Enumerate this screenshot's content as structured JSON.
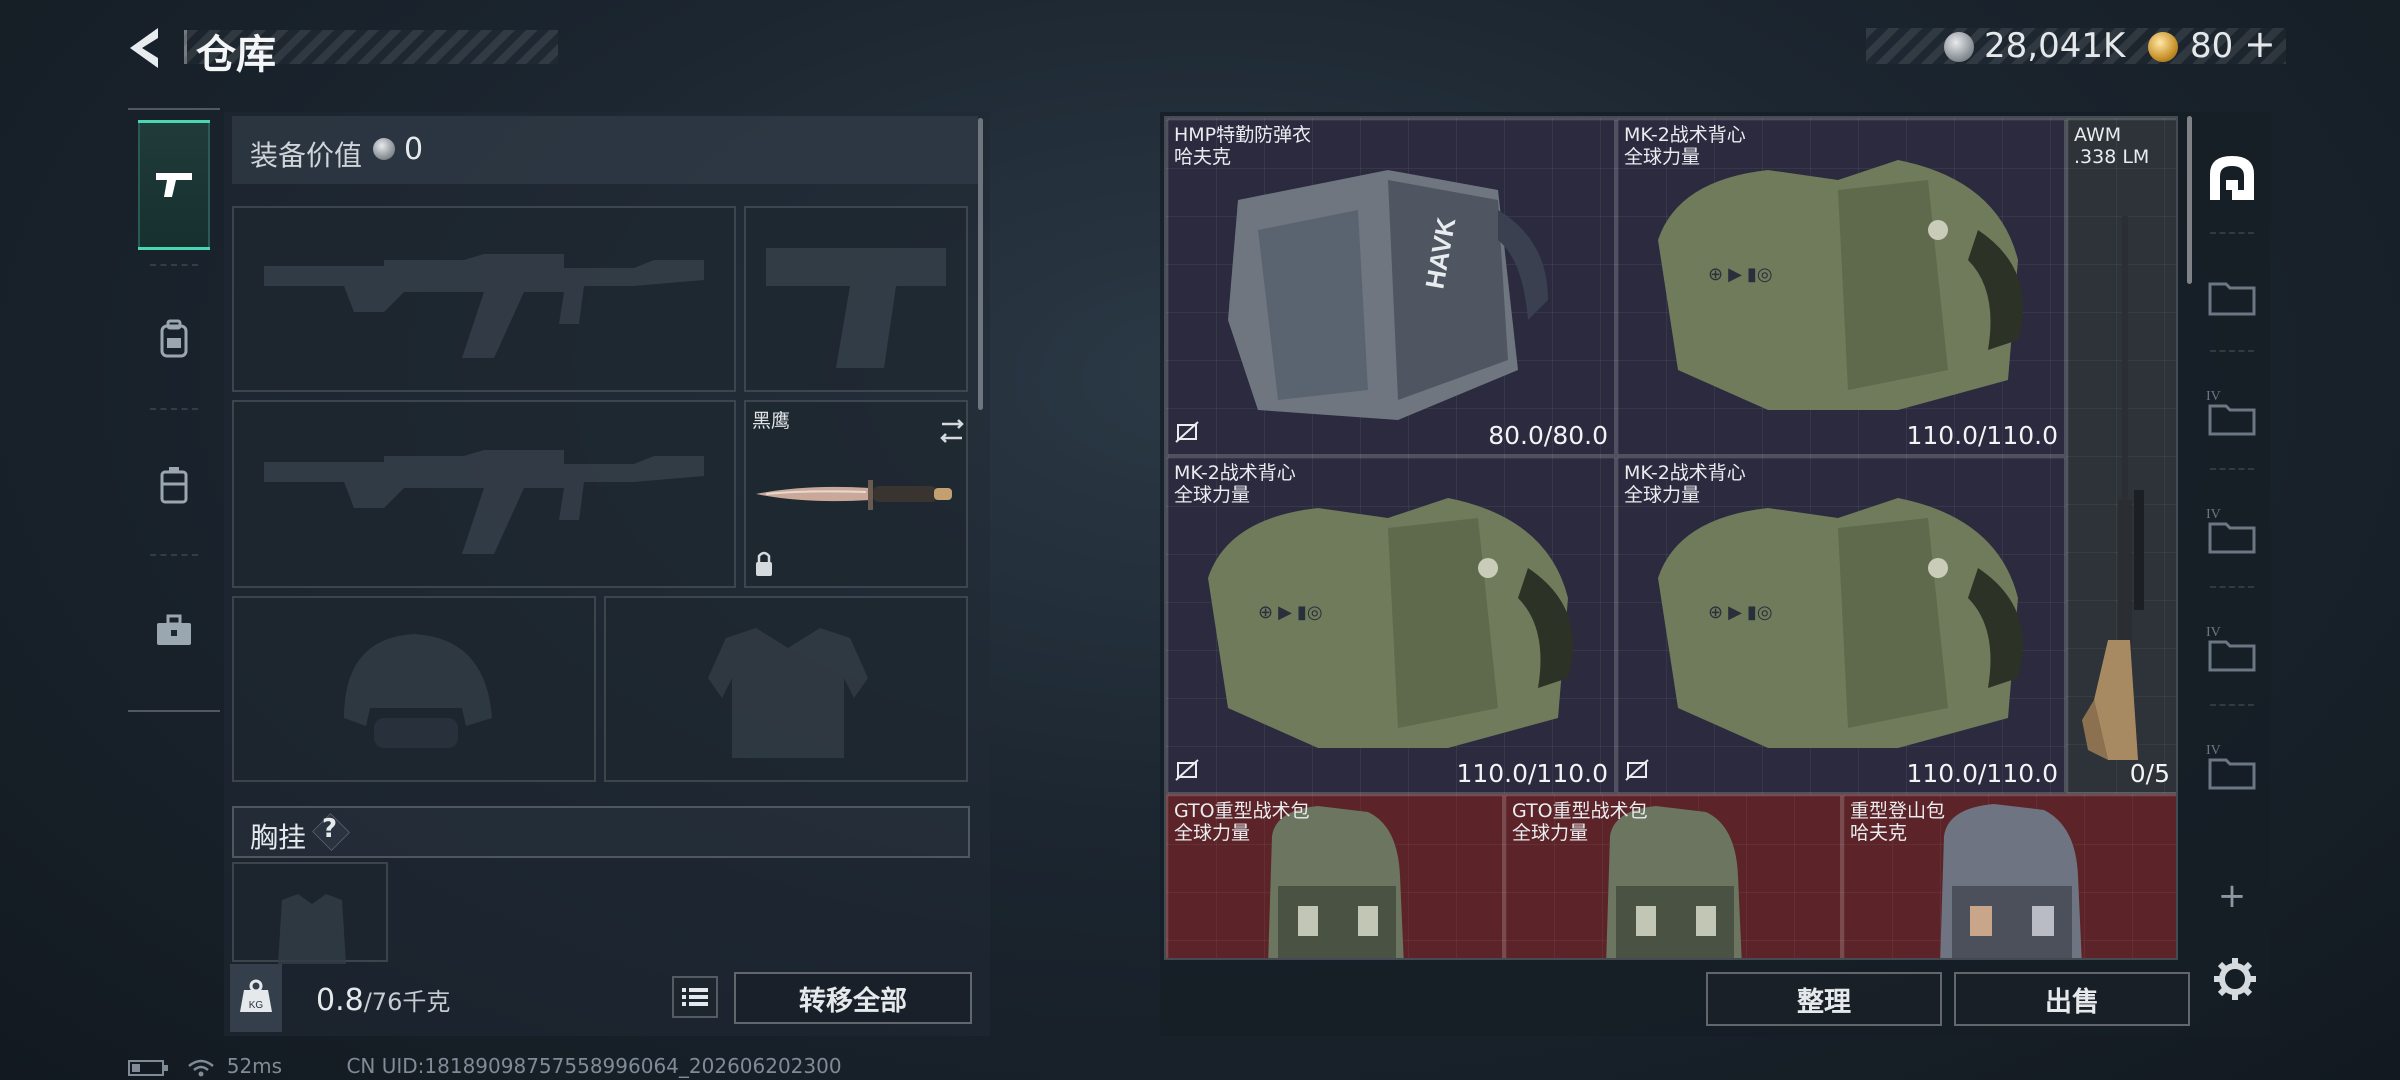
{
  "header": {
    "title": "仓库",
    "silver_amount": "28,041K",
    "gold_amount": "80",
    "gold_plus": "+",
    "icons": [
      "back-arrow-icon",
      "silver-coin-icon",
      "gold-coin-icon"
    ]
  },
  "left_rail": {
    "tabs": [
      {
        "name": "pistol-tab",
        "icon": "pistol-icon",
        "active": true
      },
      {
        "name": "backpack-tab",
        "icon": "backpack-icon",
        "active": false
      },
      {
        "name": "gear-case-tab",
        "icon": "case-icon",
        "active": false
      },
      {
        "name": "toolbox-tab",
        "icon": "toolbox-icon",
        "active": false
      }
    ],
    "accent_color": "#49d6b0"
  },
  "equipment": {
    "value_label": "装备价值",
    "value_amount": "0",
    "knife_slot_name": "黑鹰",
    "chest_rig_label": "胸挂",
    "chest_rig_help": "?",
    "weight_current": "0.8",
    "weight_max": "/76千克",
    "transfer_all_label": "转移全部"
  },
  "storage": {
    "items": [
      {
        "name": "HMP特勤防弹衣",
        "brand": "哈夫克",
        "durability": "80.0/80.0",
        "rarity": "purple"
      },
      {
        "name": "MK-2战术背心",
        "brand": "全球力量",
        "durability": "110.0/110.0",
        "rarity": "purple"
      },
      {
        "name": "AWM",
        "brand": ".338 LM",
        "durability": "0/5",
        "rarity": "grey"
      },
      {
        "name": "MK-2战术背心",
        "brand": "全球力量",
        "durability": "110.0/110.0",
        "rarity": "purple"
      },
      {
        "name": "MK-2战术背心",
        "brand": "全球力量",
        "durability": "110.0/110.0",
        "rarity": "purple"
      },
      {
        "name": "GTO重型战术包",
        "brand": "全球力量",
        "rarity": "red"
      },
      {
        "name": "GTO重型战术包",
        "brand": "全球力量",
        "rarity": "red"
      },
      {
        "name": "重型登山包",
        "brand": "哈夫克",
        "rarity": "red"
      }
    ],
    "rarity_colors": {
      "purple": "#2b2a3f",
      "grey": "#2d3338",
      "red": "#5c2429"
    }
  },
  "right_rail": {
    "items": [
      {
        "name": "storage-home-icon",
        "label": ""
      },
      {
        "name": "folder-icon",
        "label": ""
      },
      {
        "name": "folder-iv-icon",
        "label": "IV"
      },
      {
        "name": "folder-iv-icon",
        "label": "IV"
      },
      {
        "name": "folder-iv-icon",
        "label": "IV"
      },
      {
        "name": "folder-iv-icon",
        "label": "IV"
      },
      {
        "name": "add-icon",
        "label": "+"
      }
    ]
  },
  "actions": {
    "sort_label": "整理",
    "sell_label": "出售"
  },
  "status": {
    "ping": "52ms",
    "uid": "CN UID:18189098757558996064_202606202300"
  }
}
